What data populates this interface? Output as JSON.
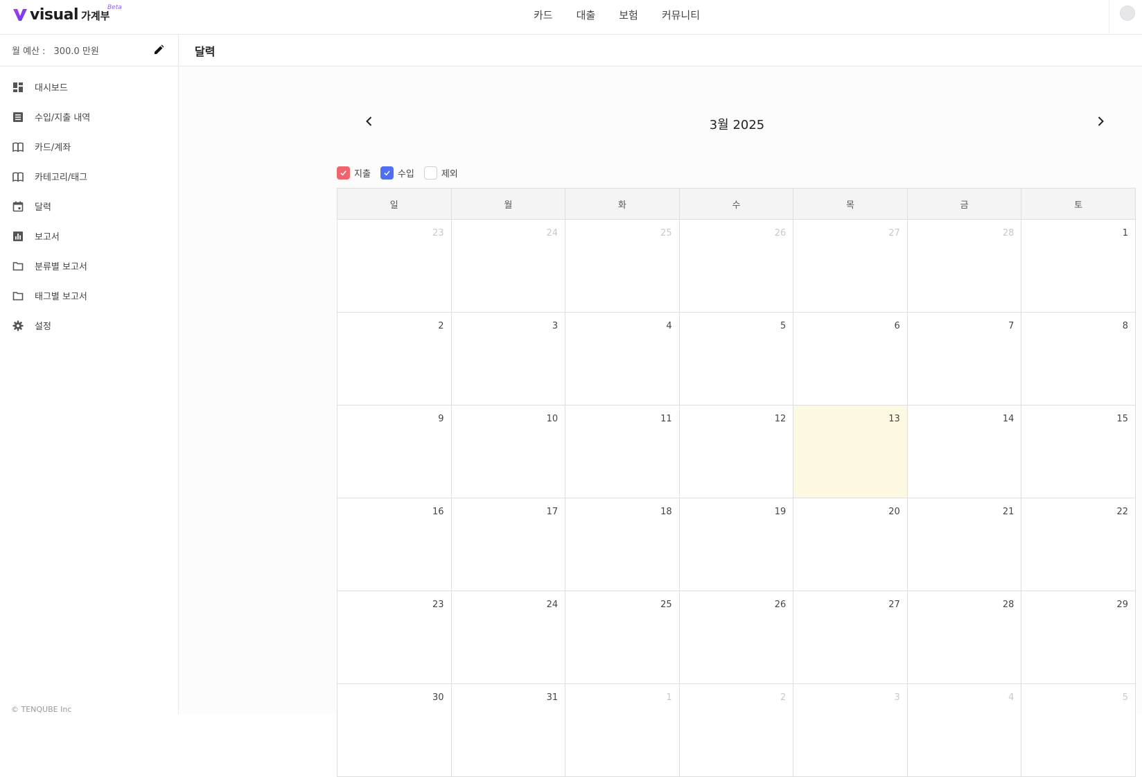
{
  "header": {
    "logo_word": "visual",
    "logo_ko": "가계부",
    "logo_badge": "Beta",
    "nav": [
      "카드",
      "대출",
      "보험",
      "커뮤니티"
    ]
  },
  "sidebar": {
    "budget_label": "월 예산 :",
    "budget_value": "300.0 만원",
    "items": [
      {
        "label": "대시보드",
        "icon": "dashboard-icon"
      },
      {
        "label": "수입/지출 내역",
        "icon": "list-icon"
      },
      {
        "label": "카드/계좌",
        "icon": "book-icon"
      },
      {
        "label": "카테고리/태그",
        "icon": "book-icon"
      },
      {
        "label": "달력",
        "icon": "calendar-icon"
      },
      {
        "label": "보고서",
        "icon": "bar-chart-icon"
      },
      {
        "label": "분류별 보고서",
        "icon": "folder-icon"
      },
      {
        "label": "태그별 보고서",
        "icon": "folder-icon"
      },
      {
        "label": "설정",
        "icon": "gear-icon"
      }
    ],
    "copyright": "© TENQUBE Inc"
  },
  "page": {
    "title": "달력",
    "month_title": "3월 2025"
  },
  "filters": [
    {
      "label": "지출",
      "checked": true,
      "color": "#f0646d"
    },
    {
      "label": "수입",
      "checked": true,
      "color": "#4e6ff0"
    },
    {
      "label": "제외",
      "checked": false,
      "color": "#ffffff"
    }
  ],
  "calendar": {
    "weekdays": [
      "일",
      "월",
      "화",
      "수",
      "목",
      "금",
      "토"
    ],
    "highlight_color": "#fdf8e1",
    "weeks": [
      [
        {
          "d": "23",
          "o": true
        },
        {
          "d": "24",
          "o": true
        },
        {
          "d": "25",
          "o": true
        },
        {
          "d": "26",
          "o": true
        },
        {
          "d": "27",
          "o": true
        },
        {
          "d": "28",
          "o": true
        },
        {
          "d": "1"
        }
      ],
      [
        {
          "d": "2"
        },
        {
          "d": "3"
        },
        {
          "d": "4"
        },
        {
          "d": "5"
        },
        {
          "d": "6"
        },
        {
          "d": "7"
        },
        {
          "d": "8"
        }
      ],
      [
        {
          "d": "9"
        },
        {
          "d": "10"
        },
        {
          "d": "11"
        },
        {
          "d": "12"
        },
        {
          "d": "13",
          "t": true
        },
        {
          "d": "14"
        },
        {
          "d": "15"
        }
      ],
      [
        {
          "d": "16"
        },
        {
          "d": "17"
        },
        {
          "d": "18"
        },
        {
          "d": "19"
        },
        {
          "d": "20"
        },
        {
          "d": "21"
        },
        {
          "d": "22"
        }
      ],
      [
        {
          "d": "23"
        },
        {
          "d": "24"
        },
        {
          "d": "25"
        },
        {
          "d": "26"
        },
        {
          "d": "27"
        },
        {
          "d": "28"
        },
        {
          "d": "29"
        }
      ],
      [
        {
          "d": "30"
        },
        {
          "d": "31"
        },
        {
          "d": "1",
          "o": true
        },
        {
          "d": "2",
          "o": true
        },
        {
          "d": "3",
          "o": true
        },
        {
          "d": "4",
          "o": true
        },
        {
          "d": "5",
          "o": true
        }
      ]
    ]
  }
}
